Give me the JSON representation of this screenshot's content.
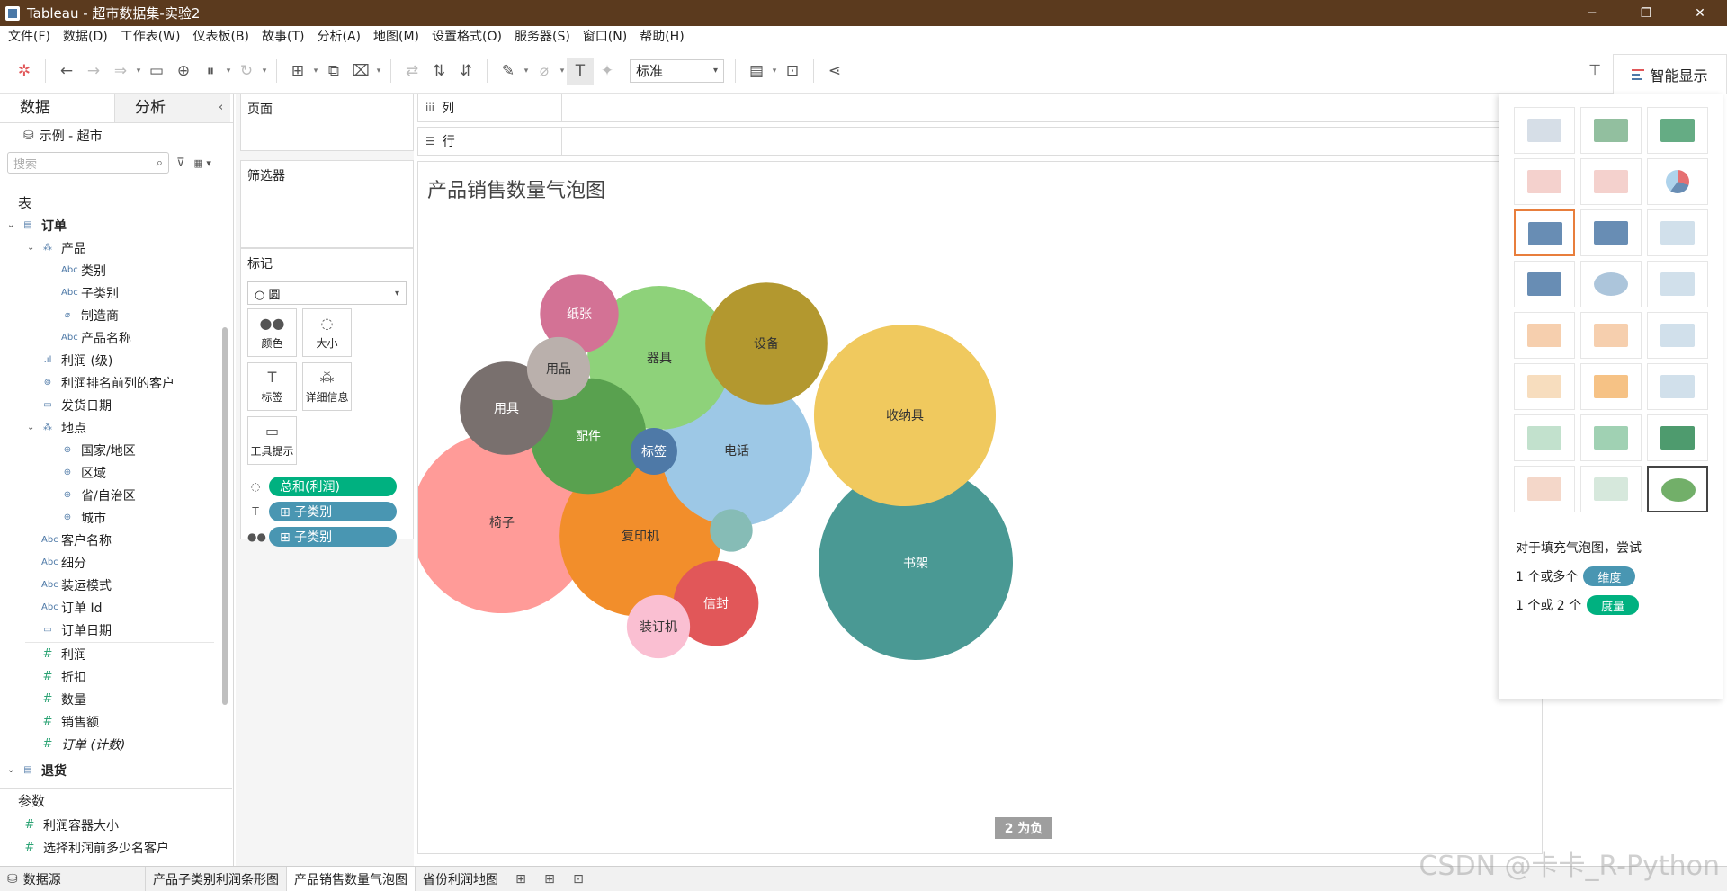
{
  "window": {
    "title": "Tableau - 超市数据集-实验2",
    "controls": [
      "─",
      "❐",
      "✕"
    ]
  },
  "menu": [
    "文件(F)",
    "数据(D)",
    "工作表(W)",
    "仪表板(B)",
    "故事(T)",
    "分析(A)",
    "地图(M)",
    "设置格式(O)",
    "服务器(S)",
    "窗口(N)",
    "帮助(H)"
  ],
  "toolbar": {
    "fit_select": "标准",
    "show_me_label": "智能显示"
  },
  "data_pane": {
    "tab_data": "数据",
    "tab_analysis": "分析",
    "datasource": "示例 - 超市",
    "search_placeholder": "搜索",
    "tables_header": "表",
    "fields": [
      {
        "label": "订单",
        "type": "table",
        "level": 0,
        "arrow": "⌄",
        "bold": true
      },
      {
        "label": "产品",
        "type": "hier",
        "level": 1,
        "arrow": "⌄"
      },
      {
        "label": "类别",
        "type": "abc",
        "level": 2
      },
      {
        "label": "子类别",
        "type": "abc",
        "level": 2
      },
      {
        "label": "制造商",
        "type": "clip",
        "level": 2
      },
      {
        "label": "产品名称",
        "type": "abc",
        "level": 2
      },
      {
        "label": "利润 (级)",
        "type": "bin",
        "level": 1
      },
      {
        "label": "利润排名前列的客户",
        "type": "set",
        "level": 1
      },
      {
        "label": "发货日期",
        "type": "date",
        "level": 1
      },
      {
        "label": "地点",
        "type": "hier",
        "level": 1,
        "arrow": "⌄"
      },
      {
        "label": "国家/地区",
        "type": "geo",
        "level": 2
      },
      {
        "label": "区域",
        "type": "geo",
        "level": 2
      },
      {
        "label": "省/自治区",
        "type": "geo",
        "level": 2
      },
      {
        "label": "城市",
        "type": "geo",
        "level": 2
      },
      {
        "label": "客户名称",
        "type": "abc",
        "level": 1
      },
      {
        "label": "细分",
        "type": "abc",
        "level": 1
      },
      {
        "label": "装运模式",
        "type": "abc",
        "level": 1
      },
      {
        "label": "订单 Id",
        "type": "abc",
        "level": 1
      },
      {
        "label": "订单日期",
        "type": "date",
        "level": 1,
        "divider": true
      },
      {
        "label": "利润",
        "type": "measure",
        "level": 1
      },
      {
        "label": "折扣",
        "type": "measure",
        "level": 1
      },
      {
        "label": "数量",
        "type": "measure",
        "level": 1
      },
      {
        "label": "销售额",
        "type": "measure",
        "level": 1
      },
      {
        "label": "订单 (计数)",
        "type": "measure",
        "level": 1,
        "italic": true
      },
      {
        "label": "退货",
        "type": "table",
        "level": 0,
        "arrow": "⌄",
        "bold": true
      }
    ],
    "params_header": "参数",
    "params": [
      "利润容器大小",
      "选择利润前多少名客户"
    ]
  },
  "cards": {
    "pages": "页面",
    "filters": "筛选器",
    "marks": "标记",
    "mark_type": "圆",
    "mark_buttons": [
      {
        "label": "颜色",
        "icon": "●●"
      },
      {
        "label": "大小",
        "icon": "◌"
      },
      {
        "label": "标签",
        "icon": "T"
      },
      {
        "label": "详细信息",
        "icon": "⁂"
      },
      {
        "label": "工具提示",
        "icon": "▭"
      }
    ],
    "pills": [
      {
        "label": "总和(利润)",
        "color": "green",
        "icon": "◌"
      },
      {
        "label": "⊞ 子类别",
        "color": "blue",
        "icon": "T"
      },
      {
        "label": "⊞ 子类别",
        "color": "blue",
        "icon": "●●"
      }
    ]
  },
  "shelves": {
    "columns": "列",
    "rows": "行"
  },
  "view": {
    "title": "产品销售数量气泡图",
    "null_indicator": "2 为负"
  },
  "chart_data": {
    "type": "bubble",
    "title": "产品销售数量气泡图",
    "size_measure": "总和(利润)",
    "label_field": "子类别",
    "note": "2 为负",
    "bubbles": [
      {
        "label": "书架",
        "value": 104,
        "color": "#4a9994",
        "text": "#ffffff"
      },
      {
        "label": "收纳具",
        "value": 91,
        "color": "#f0c95e",
        "text": "#333333"
      },
      {
        "label": "椅子",
        "value": 91,
        "color": "#ff9b98",
        "text": "#333333"
      },
      {
        "label": "复印机",
        "value": 72,
        "color": "#f28e2b",
        "text": "#333333"
      },
      {
        "label": "电话",
        "value": 63,
        "color": "#9dc8e6",
        "text": "#333333"
      },
      {
        "label": "器具",
        "value": 57,
        "color": "#8ed27a",
        "text": "#333333"
      },
      {
        "label": "设备",
        "value": 41,
        "color": "#b3982f",
        "text": "#333333"
      },
      {
        "label": "配件",
        "value": 37,
        "color": "#59a14f",
        "text": "#ffffff"
      },
      {
        "label": "用具",
        "value": 24,
        "color": "#79706e",
        "text": "#ffffff"
      },
      {
        "label": "信封",
        "value": 20,
        "color": "#e15759",
        "text": "#ffffff"
      },
      {
        "label": "纸张",
        "value": 17,
        "color": "#d37295",
        "text": "#ffffff"
      },
      {
        "label": "用品",
        "value": 11,
        "color": "#bab0ac",
        "text": "#333333"
      },
      {
        "label": "装订机",
        "value": 11,
        "color": "#fabfd2",
        "text": "#333333"
      },
      {
        "label": "标签",
        "value": 6,
        "color": "#4e79a7",
        "text": "#ffffff"
      },
      {
        "label": "",
        "value": 5,
        "color": "#86bcb6",
        "text": "#ffffff"
      }
    ]
  },
  "show_me": {
    "hint_title": "对于填充气泡图，尝试",
    "hint_dim_prefix": "1 个或多个",
    "hint_dim": "维度",
    "hint_mea_prefix": "1 个或 2 个",
    "hint_mea": "度量",
    "dim_color": "#4996b2",
    "mea_color": "#00b180"
  },
  "tabs": {
    "datasource": "数据源",
    "sheets": [
      "产品子类别利润条形图",
      "产品销售数量气泡图",
      "省份利润地图"
    ],
    "active": 1
  },
  "watermark": "CSDN @卡卡_R-Python"
}
